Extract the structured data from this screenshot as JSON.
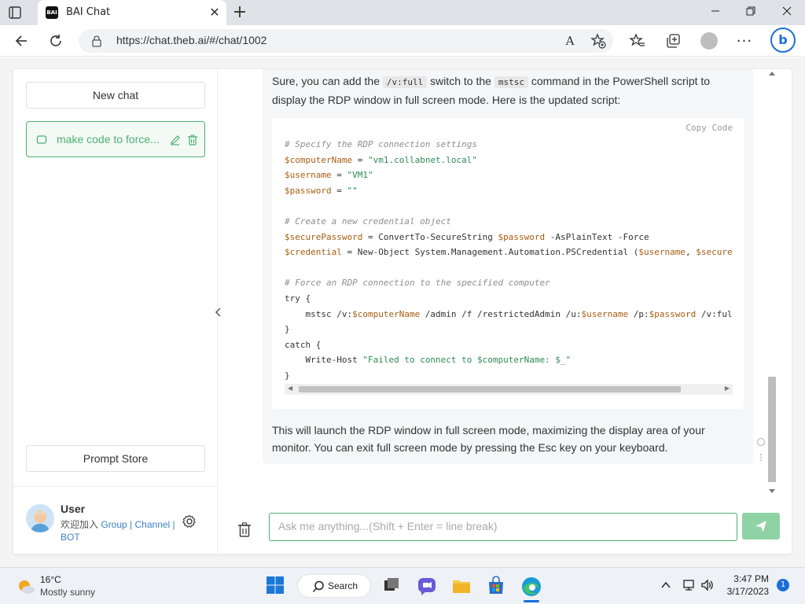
{
  "browser": {
    "tab_title": "BAI Chat",
    "tab_favicon_text": "BAI",
    "url": "https://chat.theb.ai/#/chat/1002",
    "read_aloud_label": "A",
    "profile_color": "#bdbdbd",
    "bing_label": "b"
  },
  "sidebar": {
    "new_chat_label": "New chat",
    "chat_items": [
      {
        "title": "make code to force..."
      }
    ],
    "prompt_store_label": "Prompt Store",
    "user": {
      "name": "User",
      "line_prefix": "欢迎加入 ",
      "link_group": "Group",
      "sep1": " | ",
      "link_channel": "Channel",
      "sep2": " | ",
      "link_bot": "BOT"
    }
  },
  "message": {
    "intro_before_switch": "Sure, you can add the ",
    "switch_code": "/v:full",
    "intro_middle": " switch to the ",
    "command_code": "mstsc",
    "intro_after": " command in the PowerShell script to display the RDP window in full screen mode. Here is the updated script:",
    "copy_label": "Copy Code",
    "code_lines": [
      "# Specify the RDP connection settings",
      "$computerName = \"vm1.collabnet.local\"",
      "$username = \"VM1\"",
      "$password = \"\"",
      "",
      "# Create a new credential object",
      "$securePassword = ConvertTo-SecureString $password -AsPlainText -Force",
      "$credential = New-Object System.Management.Automation.PSCredential ($username, $secureP",
      "",
      "# Force an RDP connection to the specified computer",
      "try {",
      "    mstsc /v:$computerName /admin /f /restrictedAdmin /u:$username /p:$password /v:full",
      "}",
      "catch {",
      "    Write-Host \"Failed to connect to $computerName: $_\"",
      "}"
    ],
    "outro": "This will launch the RDP window in full screen mode, maximizing the display area of your monitor. You can exit full screen mode by pressing the Esc key on your keyboard."
  },
  "input": {
    "placeholder": "Ask me anything...(Shift + Enter = line break)"
  },
  "taskbar": {
    "weather_temp": "16°C",
    "weather_desc": "Mostly sunny",
    "search_label": "Search",
    "time": "3:47 PM",
    "date": "3/17/2023",
    "notification_count": "1"
  },
  "colors": {
    "accent": "#4caf72",
    "send_button": "#8fd3a5",
    "link": "#3b82c4",
    "edge_blue": "#1a6ed8"
  }
}
